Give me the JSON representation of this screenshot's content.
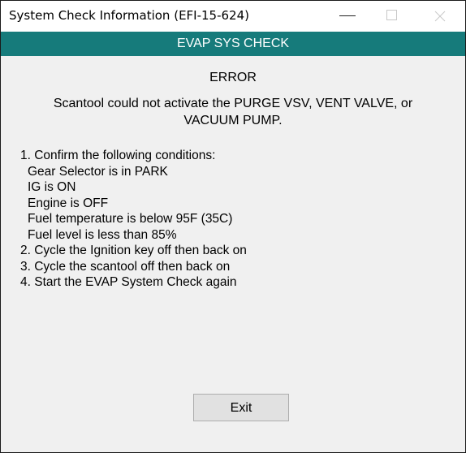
{
  "window": {
    "title": "System Check Information (EFI-15-624)",
    "controls": [
      "minimize-icon",
      "maximize-icon",
      "close-icon"
    ]
  },
  "header": {
    "title": "EVAP SYS CHECK",
    "color": "#167b7b"
  },
  "error": {
    "title": "ERROR",
    "message": "Scantool could not activate the PURGE VSV, VENT VALVE, or VACUUM PUMP."
  },
  "steps": [
    "1. Confirm the following conditions:",
    "Gear Selector is in PARK",
    "IG is ON",
    "Engine is OFF",
    "Fuel temperature is below 95F (35C)",
    "Fuel level is less than 85%",
    "2. Cycle the Ignition key off then back on",
    "3. Cycle the scantool off then back on",
    "4. Start the EVAP System Check again"
  ],
  "buttons": {
    "exit_label": "Exit"
  }
}
